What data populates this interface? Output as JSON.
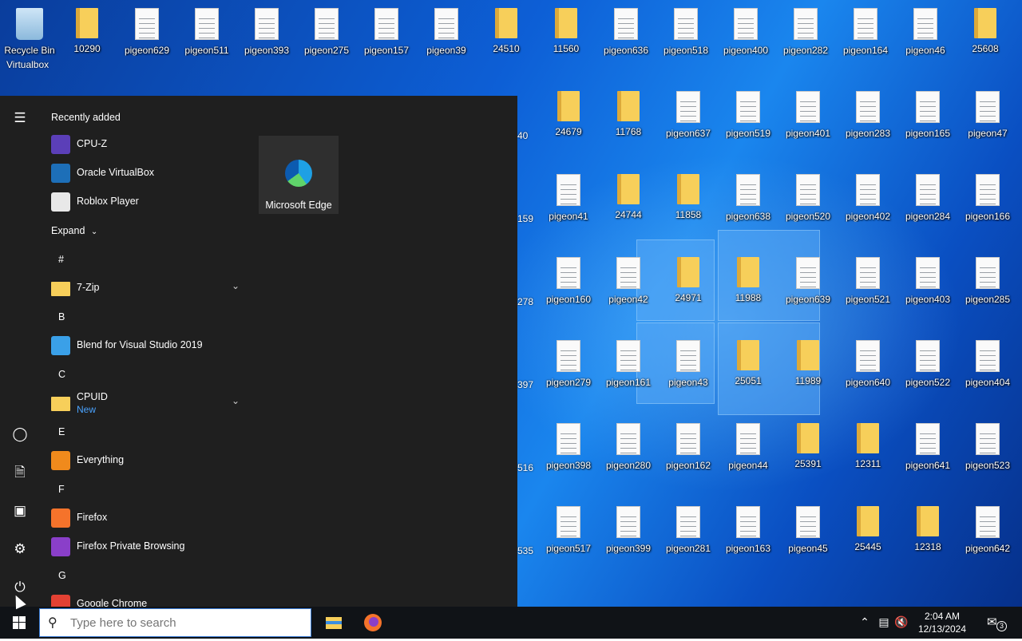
{
  "desktop": {
    "row1": [
      "Recycle Bin",
      "10290",
      "pigeon629",
      "pigeon511",
      "pigeon393",
      "pigeon275",
      "pigeon157",
      "pigeon39",
      "24510",
      "11560",
      "pigeon636",
      "pigeon518",
      "pigeon400",
      "pigeon282",
      "pigeon164",
      "pigeon46",
      "25608"
    ],
    "row1_types": [
      "recycle",
      "folder",
      "file",
      "file",
      "file",
      "file",
      "file",
      "file",
      "folder",
      "folder",
      "file",
      "file",
      "file",
      "file",
      "file",
      "file",
      "folder"
    ],
    "recycle_overlap_label": "Virtualbox",
    "grid": [
      [
        "24679",
        "11768",
        "pigeon637",
        "pigeon519",
        "pigeon401",
        "pigeon283",
        "pigeon165",
        "pigeon47"
      ],
      [
        "pigeon41",
        "24744",
        "11858",
        "pigeon638",
        "pigeon520",
        "pigeon402",
        "pigeon284",
        "pigeon166"
      ],
      [
        "pigeon160",
        "pigeon42",
        "24971",
        "11988",
        "pigeon639",
        "pigeon521",
        "pigeon403",
        "pigeon285"
      ],
      [
        "pigeon279",
        "pigeon161",
        "pigeon43",
        "25051",
        "11989",
        "pigeon640",
        "pigeon522",
        "pigeon404"
      ],
      [
        "pigeon398",
        "pigeon280",
        "pigeon162",
        "pigeon44",
        "25391",
        "12311",
        "pigeon641",
        "pigeon523"
      ],
      [
        "pigeon517",
        "pigeon399",
        "pigeon281",
        "pigeon163",
        "pigeon45",
        "25445",
        "12318",
        "pigeon642"
      ]
    ],
    "grid_types": [
      [
        "folder",
        "folder",
        "file",
        "file",
        "file",
        "file",
        "file",
        "file"
      ],
      [
        "file",
        "folder",
        "folder",
        "file",
        "file",
        "file",
        "file",
        "file"
      ],
      [
        "file",
        "file",
        "folder",
        "folder",
        "file",
        "file",
        "file",
        "file"
      ],
      [
        "file",
        "file",
        "file",
        "folder",
        "folder",
        "file",
        "file",
        "file"
      ],
      [
        "file",
        "file",
        "file",
        "file",
        "folder",
        "folder",
        "file",
        "file"
      ],
      [
        "file",
        "file",
        "file",
        "file",
        "file",
        "folder",
        "folder",
        "file"
      ]
    ],
    "partial_labels": [
      "40",
      "159",
      "278",
      "397",
      "516",
      "535"
    ]
  },
  "start_menu": {
    "recently_added": "Recently added",
    "recent_apps": [
      {
        "name": "CPU-Z",
        "icon": "cpuz-icon",
        "color": "#5b3fb8"
      },
      {
        "name": "Oracle VirtualBox",
        "icon": "virtualbox-icon",
        "color": "#1d6fb8"
      },
      {
        "name": "Roblox Player",
        "icon": "roblox-icon",
        "color": "#e8e8e8"
      }
    ],
    "expand_label": "Expand",
    "sections": [
      {
        "letter": "#",
        "apps": [
          {
            "name": "7-Zip",
            "icon": "folder-icon",
            "color": "#f7cf5a",
            "expandable": true
          }
        ]
      },
      {
        "letter": "B",
        "apps": [
          {
            "name": "Blend for Visual Studio 2019",
            "icon": "blend-icon",
            "color": "#3aa0e8"
          }
        ]
      },
      {
        "letter": "C",
        "apps": [
          {
            "name": "CPUID",
            "sub": "New",
            "icon": "folder-icon",
            "color": "#f7cf5a",
            "expandable": true
          }
        ]
      },
      {
        "letter": "E",
        "apps": [
          {
            "name": "Everything",
            "icon": "everything-icon",
            "color": "#f08a1c"
          }
        ]
      },
      {
        "letter": "F",
        "apps": [
          {
            "name": "Firefox",
            "icon": "firefox-icon",
            "color": "#f5732b"
          },
          {
            "name": "Firefox Private Browsing",
            "icon": "firefox-private-icon",
            "color": "#8a3fc9"
          }
        ]
      },
      {
        "letter": "G",
        "apps": [
          {
            "name": "Google Chrome",
            "icon": "chrome-icon",
            "color": "#e34133"
          }
        ]
      }
    ],
    "tile": {
      "name": "Microsoft Edge",
      "icon": "edge-icon"
    }
  },
  "taskbar": {
    "search_placeholder": "Type here to search",
    "time": "2:04 AM",
    "date": "12/13/2024",
    "notification_count": "3"
  }
}
